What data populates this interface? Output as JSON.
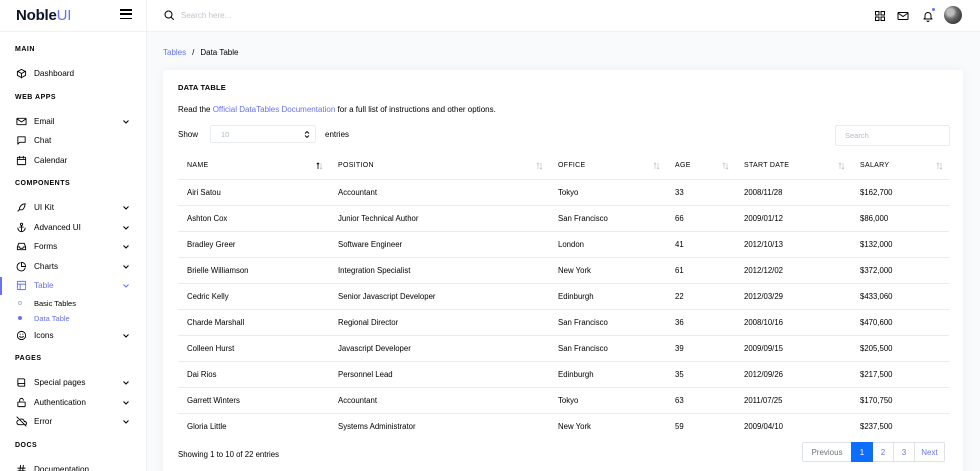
{
  "brand": {
    "name": "Noble",
    "accent": "UI"
  },
  "sidebar": {
    "sections": [
      {
        "title": "MAIN",
        "items": [
          {
            "label": "Dashboard",
            "icon": "box-icon"
          }
        ]
      },
      {
        "title": "WEB APPS",
        "items": [
          {
            "label": "Email",
            "icon": "mail-icon",
            "chevron": true
          },
          {
            "label": "Chat",
            "icon": "message-icon"
          },
          {
            "label": "Calendar",
            "icon": "calendar-icon"
          }
        ]
      },
      {
        "title": "COMPONENTS",
        "items": [
          {
            "label": "UI Kit",
            "icon": "feather-icon",
            "chevron": true
          },
          {
            "label": "Advanced UI",
            "icon": "anchor-icon",
            "chevron": true
          },
          {
            "label": "Forms",
            "icon": "inbox-icon",
            "chevron": true
          },
          {
            "label": "Charts",
            "icon": "pie-chart-icon",
            "chevron": true
          },
          {
            "label": "Table",
            "icon": "layout-icon",
            "chevron": true,
            "active": true,
            "sub": [
              {
                "label": "Basic Tables"
              },
              {
                "label": "Data Table",
                "active": true
              }
            ]
          },
          {
            "label": "Icons",
            "icon": "smile-icon",
            "chevron": true
          }
        ]
      },
      {
        "title": "PAGES",
        "items": [
          {
            "label": "Special pages",
            "icon": "book-icon",
            "chevron": true
          },
          {
            "label": "Authentication",
            "icon": "unlock-icon",
            "chevron": true
          },
          {
            "label": "Error",
            "icon": "cloud-off-icon",
            "chevron": true
          }
        ]
      },
      {
        "title": "DOCS",
        "items": [
          {
            "label": "Documentation",
            "icon": "hash-icon"
          }
        ]
      }
    ]
  },
  "topbar": {
    "search_placeholder": "Search here..."
  },
  "breadcrumb": {
    "parent": "Tables",
    "sep": "/",
    "current": "Data Table"
  },
  "card": {
    "title": "DATA TABLE",
    "desc_pre": "Read the ",
    "desc_link": "Official DataTables Documentation",
    "desc_post": " for a full list of instructions and other options.",
    "show_label": "Show",
    "show_value": "10",
    "entries_label": "entries",
    "search_placeholder": "Search"
  },
  "table": {
    "columns": [
      "NAME",
      "POSITION",
      "OFFICE",
      "AGE",
      "START DATE",
      "SALARY"
    ],
    "rows": [
      [
        "Airi Satou",
        "Accountant",
        "Tokyo",
        "33",
        "2008/11/28",
        "$162,700"
      ],
      [
        "Ashton Cox",
        "Junior Technical Author",
        "San Francisco",
        "66",
        "2009/01/12",
        "$86,000"
      ],
      [
        "Bradley Greer",
        "Software Engineer",
        "London",
        "41",
        "2012/10/13",
        "$132,000"
      ],
      [
        "Brielle Williamson",
        "Integration Specialist",
        "New York",
        "61",
        "2012/12/02",
        "$372,000"
      ],
      [
        "Cedric Kelly",
        "Senior Javascript Developer",
        "Edinburgh",
        "22",
        "2012/03/29",
        "$433,060"
      ],
      [
        "Charde Marshall",
        "Regional Director",
        "San Francisco",
        "36",
        "2008/10/16",
        "$470,600"
      ],
      [
        "Colleen Hurst",
        "Javascript Developer",
        "San Francisco",
        "39",
        "2009/09/15",
        "$205,500"
      ],
      [
        "Dai Rios",
        "Personnel Lead",
        "Edinburgh",
        "35",
        "2012/09/26",
        "$217,500"
      ],
      [
        "Garrett Winters",
        "Accountant",
        "Tokyo",
        "63",
        "2011/07/25",
        "$170,750"
      ],
      [
        "Gloria Little",
        "Systems Administrator",
        "New York",
        "59",
        "2009/04/10",
        "$237,500"
      ]
    ]
  },
  "footer": {
    "info": "Showing 1 to 10 of 22 entries",
    "prev": "Previous",
    "pages": [
      "1",
      "2",
      "3"
    ],
    "active_page": "1",
    "next": "Next"
  },
  "colors": {
    "accent": "#6571ff",
    "page_active": "#0d6efd"
  }
}
